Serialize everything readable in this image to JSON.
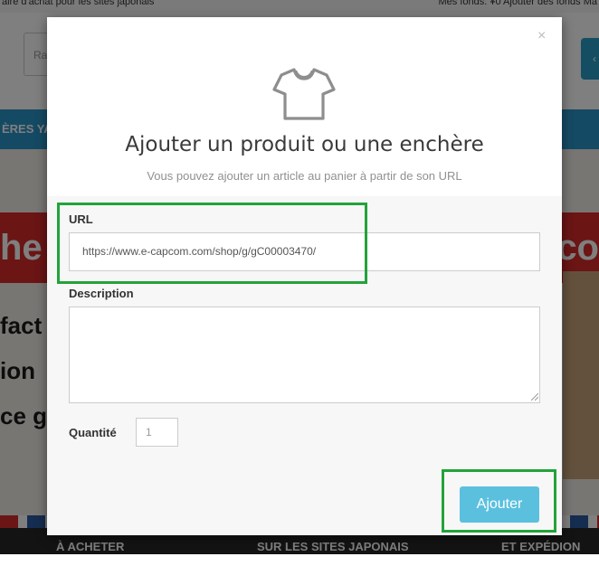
{
  "background": {
    "topbar_left": "aire d'achat pour les sites japonais",
    "topbar_right": "Mes fonds: ¥0    Ajouter des fonds    Ma",
    "search_placeholder": "Ra",
    "blue_strip_text": "ÈRES YA",
    "red_band_left": "he",
    "red_band_right": "co",
    "hero_lines": [
      "fact",
      "ion",
      "ce g"
    ],
    "nav_items": [
      "À ACHETER",
      "SUR LES SITES JAPONAIS",
      "ET EXPÉDION"
    ]
  },
  "modal": {
    "close_label": "×",
    "icon": "tshirt-icon",
    "title": "Ajouter un produit ou une enchère",
    "subtitle": "Vous pouvez ajouter un article au panier à partir de son URL",
    "url_label": "URL",
    "url_value": "https://www.e-capcom.com/shop/g/gC00003470/",
    "description_label": "Description",
    "description_value": "",
    "quantity_label": "Quantité",
    "quantity_placeholder": "1",
    "submit_label": "Ajouter"
  },
  "colors": {
    "overlay": "rgba(0,0,0,0.5)",
    "primary_button": "#5bc0de",
    "highlight": "#22a33a"
  }
}
